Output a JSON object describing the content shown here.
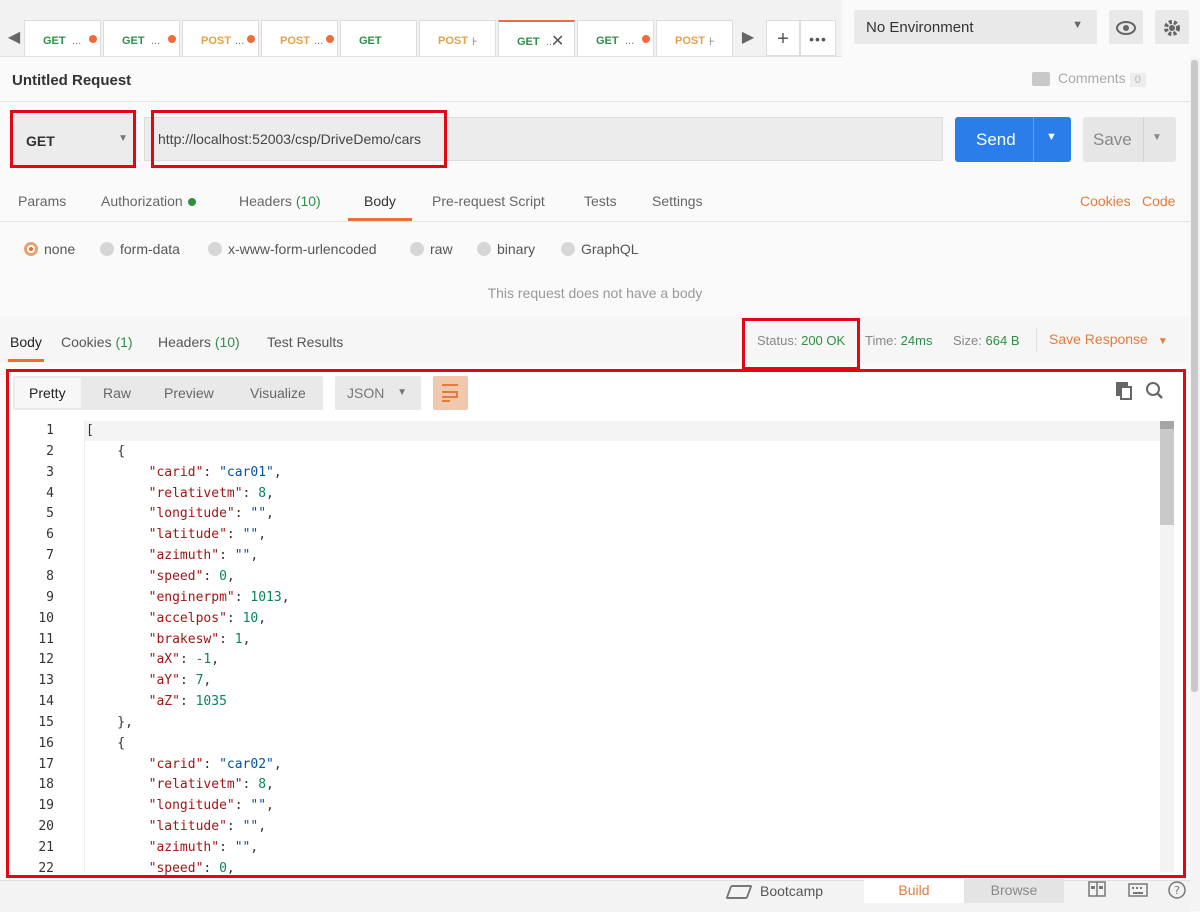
{
  "tabs": [
    {
      "method": "GET",
      "name": "...",
      "state": "dot"
    },
    {
      "method": "GET",
      "name": "...",
      "state": "dot"
    },
    {
      "method": "POST",
      "name": "...",
      "state": "dot"
    },
    {
      "method": "POST",
      "name": "...",
      "state": "dot"
    },
    {
      "method": "GET",
      "name": "",
      "state": "none"
    },
    {
      "method": "POST",
      "name": "⊦",
      "state": "none"
    },
    {
      "method": "GET",
      "name": "...",
      "state": "active"
    },
    {
      "method": "GET",
      "name": "...",
      "state": "dot"
    },
    {
      "method": "POST",
      "name": "⊦",
      "state": "none"
    }
  ],
  "environment": {
    "selected": "No Environment"
  },
  "request": {
    "title": "Untitled Request",
    "comments_label": "Comments",
    "comments_count": "0",
    "method": "GET",
    "url": "http://localhost:52003/csp/DriveDemo/cars",
    "send_label": "Send",
    "save_label": "Save"
  },
  "request_tabs": {
    "params": "Params",
    "authorization": "Authorization",
    "headers": "Headers",
    "headers_count": "(10)",
    "body": "Body",
    "prerequest": "Pre-request Script",
    "tests": "Tests",
    "settings": "Settings",
    "cookies": "Cookies",
    "code": "Code"
  },
  "body_types": {
    "none": "none",
    "form_data": "form-data",
    "urlencoded": "x-www-form-urlencoded",
    "raw": "raw",
    "binary": "binary",
    "graphql": "GraphQL",
    "selected": "none"
  },
  "no_body_message": "This request does not have a body",
  "response_tabs": {
    "body": "Body",
    "cookies": "Cookies",
    "cookies_count": "(1)",
    "headers": "Headers",
    "headers_count": "(10)",
    "test_results": "Test Results"
  },
  "response_meta": {
    "status_label": "Status:",
    "status_value": "200 OK",
    "time_label": "Time:",
    "time_value": "24ms",
    "size_label": "Size:",
    "size_value": "664 B",
    "save_response": "Save Response"
  },
  "viewer": {
    "pretty": "Pretty",
    "raw": "Raw",
    "preview": "Preview",
    "visualize": "Visualize",
    "format": "JSON"
  },
  "code_lines": [
    {
      "n": "1",
      "t": "["
    },
    {
      "n": "2",
      "t": "    {"
    },
    {
      "n": "3",
      "t": "        \"carid\": \"car01\","
    },
    {
      "n": "4",
      "t": "        \"relativetm\": 8,"
    },
    {
      "n": "5",
      "t": "        \"longitude\": \"\","
    },
    {
      "n": "6",
      "t": "        \"latitude\": \"\","
    },
    {
      "n": "7",
      "t": "        \"azimuth\": \"\","
    },
    {
      "n": "8",
      "t": "        \"speed\": 0,"
    },
    {
      "n": "9",
      "t": "        \"enginerpm\": 1013,"
    },
    {
      "n": "10",
      "t": "        \"accelpos\": 10,"
    },
    {
      "n": "11",
      "t": "        \"brakesw\": 1,"
    },
    {
      "n": "12",
      "t": "        \"aX\": -1,"
    },
    {
      "n": "13",
      "t": "        \"aY\": 7,"
    },
    {
      "n": "14",
      "t": "        \"aZ\": 1035"
    },
    {
      "n": "15",
      "t": "    },"
    },
    {
      "n": "16",
      "t": "    {"
    },
    {
      "n": "17",
      "t": "        \"carid\": \"car02\","
    },
    {
      "n": "18",
      "t": "        \"relativetm\": 8,"
    },
    {
      "n": "19",
      "t": "        \"longitude\": \"\","
    },
    {
      "n": "20",
      "t": "        \"latitude\": \"\","
    },
    {
      "n": "21",
      "t": "        \"azimuth\": \"\","
    },
    {
      "n": "22",
      "t": "        \"speed\": 0,"
    }
  ],
  "footer": {
    "bootcamp": "Bootcamp",
    "build": "Build",
    "browse": "Browse"
  },
  "colors": {
    "accent": "#f26b3a",
    "send": "#2b7de9",
    "highlight": "#e30613",
    "status_ok": "#2f8f46"
  }
}
